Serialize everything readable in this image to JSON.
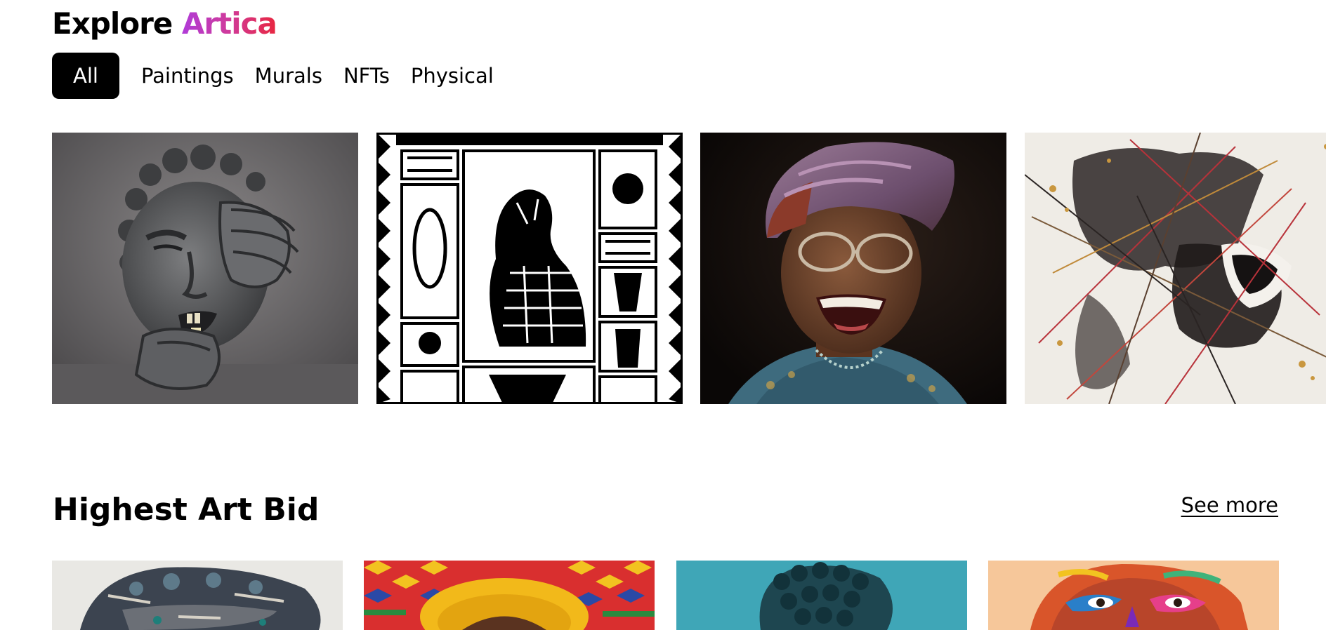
{
  "brand": {
    "prefix": "Explore",
    "accent": "Artica",
    "accent_colors": [
      "#b03bd8",
      "#e8263f"
    ]
  },
  "tabs": [
    {
      "label": "All",
      "active": true
    },
    {
      "label": "Paintings",
      "active": false
    },
    {
      "label": "Murals",
      "active": false
    },
    {
      "label": "NFTs",
      "active": false
    },
    {
      "label": "Physical",
      "active": false
    }
  ],
  "gallery": {
    "items": [
      {
        "subject": "clay-sculpture-face"
      },
      {
        "subject": "black-white-linocut-panther"
      },
      {
        "subject": "laughing-elder-woman-headwrap"
      },
      {
        "subject": "ink-splatter-laughing-portrait"
      }
    ]
  },
  "highest_bid": {
    "title": "Highest Art Bid",
    "see_more": "See more",
    "items": [
      {
        "subject": "textured-paint-portrait"
      },
      {
        "subject": "kente-pattern-yellow-hat"
      },
      {
        "subject": "teal-braided-hair"
      },
      {
        "subject": "colorful-pop-portrait"
      }
    ]
  }
}
